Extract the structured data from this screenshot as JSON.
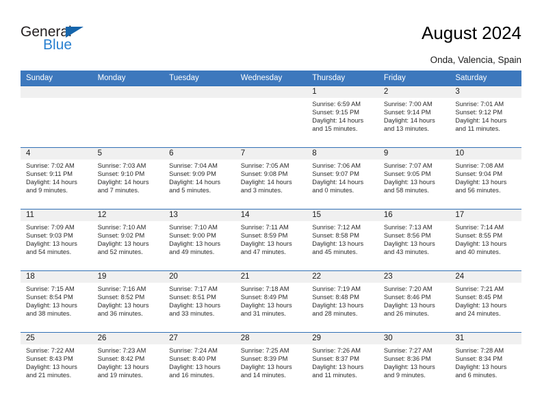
{
  "brand": {
    "name_part1": "General",
    "name_part2": "Blue",
    "triangle_icon": "triangle-icon",
    "accent_color": "#2980d0",
    "dark_color": "#231f20"
  },
  "header": {
    "title": "August 2024",
    "subtitle": "Onda, Valencia, Spain"
  },
  "theme": {
    "header_blue": "#3d78bd",
    "row_border_blue": "#2f6fb5",
    "daynum_band": "#f0f0f0"
  },
  "calendar": {
    "columns": [
      "Sunday",
      "Monday",
      "Tuesday",
      "Wednesday",
      "Thursday",
      "Friday",
      "Saturday"
    ],
    "labels": {
      "sunrise_prefix": "Sunrise:",
      "sunset_prefix": "Sunset:",
      "daylight_prefix": "Daylight:"
    },
    "weeks": [
      [
        {
          "day": "",
          "blank": true
        },
        {
          "day": "",
          "blank": true
        },
        {
          "day": "",
          "blank": true
        },
        {
          "day": "",
          "blank": true
        },
        {
          "day": "1",
          "sunrise": "Sunrise: 6:59 AM",
          "sunset": "Sunset: 9:15 PM",
          "daylight_l1": "Daylight: 14 hours",
          "daylight_l2": "and 15 minutes."
        },
        {
          "day": "2",
          "sunrise": "Sunrise: 7:00 AM",
          "sunset": "Sunset: 9:14 PM",
          "daylight_l1": "Daylight: 14 hours",
          "daylight_l2": "and 13 minutes."
        },
        {
          "day": "3",
          "sunrise": "Sunrise: 7:01 AM",
          "sunset": "Sunset: 9:12 PM",
          "daylight_l1": "Daylight: 14 hours",
          "daylight_l2": "and 11 minutes."
        }
      ],
      [
        {
          "day": "4",
          "sunrise": "Sunrise: 7:02 AM",
          "sunset": "Sunset: 9:11 PM",
          "daylight_l1": "Daylight: 14 hours",
          "daylight_l2": "and 9 minutes."
        },
        {
          "day": "5",
          "sunrise": "Sunrise: 7:03 AM",
          "sunset": "Sunset: 9:10 PM",
          "daylight_l1": "Daylight: 14 hours",
          "daylight_l2": "and 7 minutes."
        },
        {
          "day": "6",
          "sunrise": "Sunrise: 7:04 AM",
          "sunset": "Sunset: 9:09 PM",
          "daylight_l1": "Daylight: 14 hours",
          "daylight_l2": "and 5 minutes."
        },
        {
          "day": "7",
          "sunrise": "Sunrise: 7:05 AM",
          "sunset": "Sunset: 9:08 PM",
          "daylight_l1": "Daylight: 14 hours",
          "daylight_l2": "and 3 minutes."
        },
        {
          "day": "8",
          "sunrise": "Sunrise: 7:06 AM",
          "sunset": "Sunset: 9:07 PM",
          "daylight_l1": "Daylight: 14 hours",
          "daylight_l2": "and 0 minutes."
        },
        {
          "day": "9",
          "sunrise": "Sunrise: 7:07 AM",
          "sunset": "Sunset: 9:05 PM",
          "daylight_l1": "Daylight: 13 hours",
          "daylight_l2": "and 58 minutes."
        },
        {
          "day": "10",
          "sunrise": "Sunrise: 7:08 AM",
          "sunset": "Sunset: 9:04 PM",
          "daylight_l1": "Daylight: 13 hours",
          "daylight_l2": "and 56 minutes."
        }
      ],
      [
        {
          "day": "11",
          "sunrise": "Sunrise: 7:09 AM",
          "sunset": "Sunset: 9:03 PM",
          "daylight_l1": "Daylight: 13 hours",
          "daylight_l2": "and 54 minutes."
        },
        {
          "day": "12",
          "sunrise": "Sunrise: 7:10 AM",
          "sunset": "Sunset: 9:02 PM",
          "daylight_l1": "Daylight: 13 hours",
          "daylight_l2": "and 52 minutes."
        },
        {
          "day": "13",
          "sunrise": "Sunrise: 7:10 AM",
          "sunset": "Sunset: 9:00 PM",
          "daylight_l1": "Daylight: 13 hours",
          "daylight_l2": "and 49 minutes."
        },
        {
          "day": "14",
          "sunrise": "Sunrise: 7:11 AM",
          "sunset": "Sunset: 8:59 PM",
          "daylight_l1": "Daylight: 13 hours",
          "daylight_l2": "and 47 minutes."
        },
        {
          "day": "15",
          "sunrise": "Sunrise: 7:12 AM",
          "sunset": "Sunset: 8:58 PM",
          "daylight_l1": "Daylight: 13 hours",
          "daylight_l2": "and 45 minutes."
        },
        {
          "day": "16",
          "sunrise": "Sunrise: 7:13 AM",
          "sunset": "Sunset: 8:56 PM",
          "daylight_l1": "Daylight: 13 hours",
          "daylight_l2": "and 43 minutes."
        },
        {
          "day": "17",
          "sunrise": "Sunrise: 7:14 AM",
          "sunset": "Sunset: 8:55 PM",
          "daylight_l1": "Daylight: 13 hours",
          "daylight_l2": "and 40 minutes."
        }
      ],
      [
        {
          "day": "18",
          "sunrise": "Sunrise: 7:15 AM",
          "sunset": "Sunset: 8:54 PM",
          "daylight_l1": "Daylight: 13 hours",
          "daylight_l2": "and 38 minutes."
        },
        {
          "day": "19",
          "sunrise": "Sunrise: 7:16 AM",
          "sunset": "Sunset: 8:52 PM",
          "daylight_l1": "Daylight: 13 hours",
          "daylight_l2": "and 36 minutes."
        },
        {
          "day": "20",
          "sunrise": "Sunrise: 7:17 AM",
          "sunset": "Sunset: 8:51 PM",
          "daylight_l1": "Daylight: 13 hours",
          "daylight_l2": "and 33 minutes."
        },
        {
          "day": "21",
          "sunrise": "Sunrise: 7:18 AM",
          "sunset": "Sunset: 8:49 PM",
          "daylight_l1": "Daylight: 13 hours",
          "daylight_l2": "and 31 minutes."
        },
        {
          "day": "22",
          "sunrise": "Sunrise: 7:19 AM",
          "sunset": "Sunset: 8:48 PM",
          "daylight_l1": "Daylight: 13 hours",
          "daylight_l2": "and 28 minutes."
        },
        {
          "day": "23",
          "sunrise": "Sunrise: 7:20 AM",
          "sunset": "Sunset: 8:46 PM",
          "daylight_l1": "Daylight: 13 hours",
          "daylight_l2": "and 26 minutes."
        },
        {
          "day": "24",
          "sunrise": "Sunrise: 7:21 AM",
          "sunset": "Sunset: 8:45 PM",
          "daylight_l1": "Daylight: 13 hours",
          "daylight_l2": "and 24 minutes."
        }
      ],
      [
        {
          "day": "25",
          "sunrise": "Sunrise: 7:22 AM",
          "sunset": "Sunset: 8:43 PM",
          "daylight_l1": "Daylight: 13 hours",
          "daylight_l2": "and 21 minutes."
        },
        {
          "day": "26",
          "sunrise": "Sunrise: 7:23 AM",
          "sunset": "Sunset: 8:42 PM",
          "daylight_l1": "Daylight: 13 hours",
          "daylight_l2": "and 19 minutes."
        },
        {
          "day": "27",
          "sunrise": "Sunrise: 7:24 AM",
          "sunset": "Sunset: 8:40 PM",
          "daylight_l1": "Daylight: 13 hours",
          "daylight_l2": "and 16 minutes."
        },
        {
          "day": "28",
          "sunrise": "Sunrise: 7:25 AM",
          "sunset": "Sunset: 8:39 PM",
          "daylight_l1": "Daylight: 13 hours",
          "daylight_l2": "and 14 minutes."
        },
        {
          "day": "29",
          "sunrise": "Sunrise: 7:26 AM",
          "sunset": "Sunset: 8:37 PM",
          "daylight_l1": "Daylight: 13 hours",
          "daylight_l2": "and 11 minutes."
        },
        {
          "day": "30",
          "sunrise": "Sunrise: 7:27 AM",
          "sunset": "Sunset: 8:36 PM",
          "daylight_l1": "Daylight: 13 hours",
          "daylight_l2": "and 9 minutes."
        },
        {
          "day": "31",
          "sunrise": "Sunrise: 7:28 AM",
          "sunset": "Sunset: 8:34 PM",
          "daylight_l1": "Daylight: 13 hours",
          "daylight_l2": "and 6 minutes."
        }
      ]
    ]
  }
}
